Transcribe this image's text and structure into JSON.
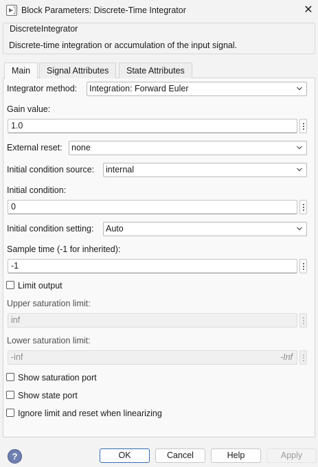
{
  "window": {
    "title": "Block Parameters: Discrete-Time Integrator",
    "close_glyph": "✕"
  },
  "block": {
    "type": "DiscreteIntegrator",
    "description": "Discrete-time integration or accumulation of the input signal."
  },
  "tabs": [
    {
      "label": "Main",
      "active": true
    },
    {
      "label": "Signal Attributes",
      "active": false
    },
    {
      "label": "State Attributes",
      "active": false
    }
  ],
  "main": {
    "integrator_method": {
      "label": "Integrator method:",
      "value": "Integration: Forward Euler"
    },
    "gain": {
      "label": "Gain value:",
      "value": "1.0"
    },
    "external_reset": {
      "label": "External reset:",
      "value": "none"
    },
    "initial_condition_source": {
      "label": "Initial condition source:",
      "value": "internal"
    },
    "initial_condition": {
      "label": "Initial condition:",
      "value": "0"
    },
    "initial_condition_setting": {
      "label": "Initial condition setting:",
      "value": "Auto"
    },
    "sample_time": {
      "label": "Sample time (-1 for inherited):",
      "value": "-1"
    },
    "limit_output": {
      "label": "Limit output",
      "checked": false
    },
    "upper_limit": {
      "label": "Upper saturation limit:",
      "value": "inf",
      "enabled": false
    },
    "lower_limit": {
      "label": "Lower saturation limit:",
      "value": "-inf",
      "suffix": "-Inf",
      "enabled": false
    },
    "show_saturation_port": {
      "label": "Show saturation port",
      "checked": false
    },
    "show_state_port": {
      "label": "Show state port",
      "checked": false
    },
    "ignore_limit": {
      "label": "Ignore limit and reset when linearizing",
      "checked": false
    }
  },
  "footer": {
    "help_glyph": "?",
    "ok": "OK",
    "cancel": "Cancel",
    "help": "Help",
    "apply": "Apply"
  },
  "colors": {
    "window_bg": "#f3f3f3",
    "panel_bg": "#f9f9f9",
    "default_button_border": "#2f6fb7",
    "help_icon": "#6e7fb0"
  },
  "icons": [
    "block-params-icon",
    "close-icon",
    "chevron-down-icon",
    "more-options-icon",
    "help-icon"
  ]
}
